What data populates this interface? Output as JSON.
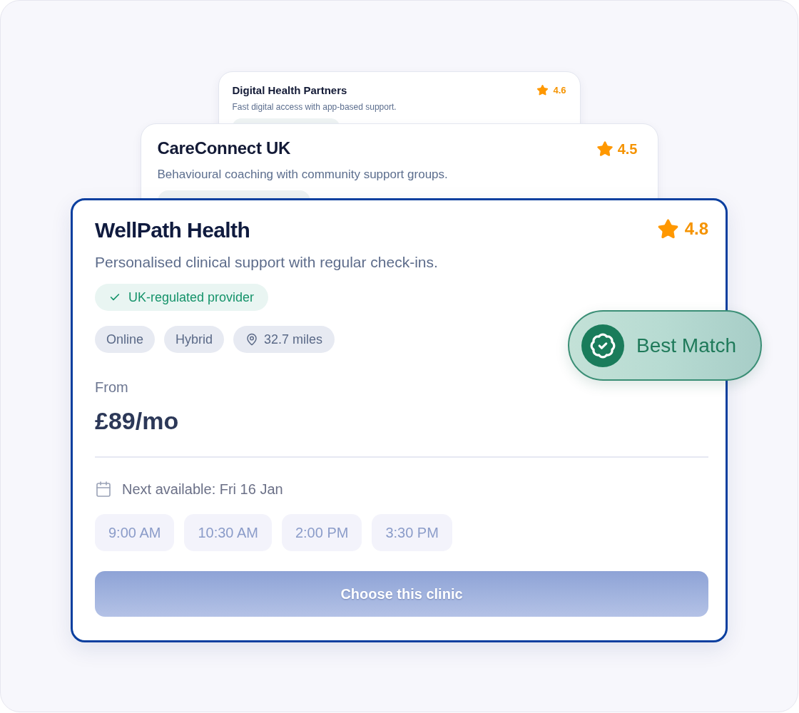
{
  "stacked_cards": [
    {
      "title": "Digital Health Partners",
      "rating": "4.6",
      "description": "Fast digital access with app-based support."
    },
    {
      "title": "CareConnect UK",
      "rating": "4.5",
      "description": "Behavioural coaching with community support groups."
    }
  ],
  "featured_card": {
    "title": "WellPath Health",
    "rating": "4.8",
    "description": "Personalised clinical support with regular check-ins.",
    "verified_badge": "UK-regulated provider",
    "tags": [
      {
        "kind": "plain",
        "label": "Online"
      },
      {
        "kind": "plain",
        "label": "Hybrid"
      },
      {
        "kind": "distance",
        "label": "32.7 miles"
      }
    ],
    "price_label": "From",
    "price": "£89/mo",
    "next_available": "Next available: Fri 16 Jan",
    "time_slots": [
      {
        "label": "9:00 AM",
        "selected": false
      },
      {
        "label": "10:30 AM",
        "selected": false
      },
      {
        "label": "2:00 PM",
        "selected": false
      },
      {
        "label": "3:30 PM",
        "selected": false
      }
    ],
    "cta": {
      "label": "Choose this clinic",
      "disabled": true
    },
    "highlight_badge": "Best Match"
  }
}
